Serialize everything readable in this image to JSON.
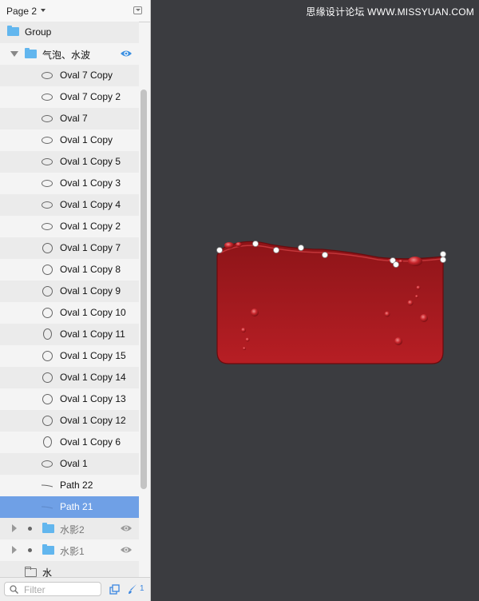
{
  "page_selector": {
    "title": "Page 2"
  },
  "layers": {
    "group": "Group",
    "bubble_group": "气泡、水波",
    "items": [
      {
        "label": "Oval 7 Copy",
        "shape": "h"
      },
      {
        "label": "Oval 7 Copy 2",
        "shape": "h"
      },
      {
        "label": "Oval 7",
        "shape": "h"
      },
      {
        "label": "Oval 1 Copy",
        "shape": "h"
      },
      {
        "label": "Oval 1 Copy 5",
        "shape": "h"
      },
      {
        "label": "Oval 1 Copy 3",
        "shape": "h"
      },
      {
        "label": "Oval 1 Copy 4",
        "shape": "h"
      },
      {
        "label": "Oval 1 Copy 2",
        "shape": "h"
      },
      {
        "label": "Oval 1 Copy 7",
        "shape": "c"
      },
      {
        "label": "Oval 1 Copy 8",
        "shape": "c"
      },
      {
        "label": "Oval 1 Copy 9",
        "shape": "c"
      },
      {
        "label": "Oval 1 Copy 10",
        "shape": "c"
      },
      {
        "label": "Oval 1 Copy 11",
        "shape": "v"
      },
      {
        "label": "Oval 1 Copy 15",
        "shape": "c"
      },
      {
        "label": "Oval 1 Copy 14",
        "shape": "c"
      },
      {
        "label": "Oval 1 Copy 13",
        "shape": "c"
      },
      {
        "label": "Oval 1 Copy 12",
        "shape": "c"
      },
      {
        "label": "Oval 1 Copy 6",
        "shape": "v"
      },
      {
        "label": "Oval 1",
        "shape": "h"
      },
      {
        "label": "Path 22",
        "shape": "path"
      },
      {
        "label": "Path 21",
        "shape": "path"
      }
    ],
    "shadow2": "水影2",
    "shadow1": "水影1",
    "water": "水"
  },
  "filter": {
    "placeholder": "Filter"
  },
  "toolbar": {
    "brush_count": "1"
  },
  "watermark": "思缘设计论坛 WWW.MISSYUAN.COM",
  "colors": {
    "selection": "#6fa0e6",
    "folder": "#62b6ee",
    "water_red": "#b31d22",
    "canvas": "#3b3c40"
  }
}
